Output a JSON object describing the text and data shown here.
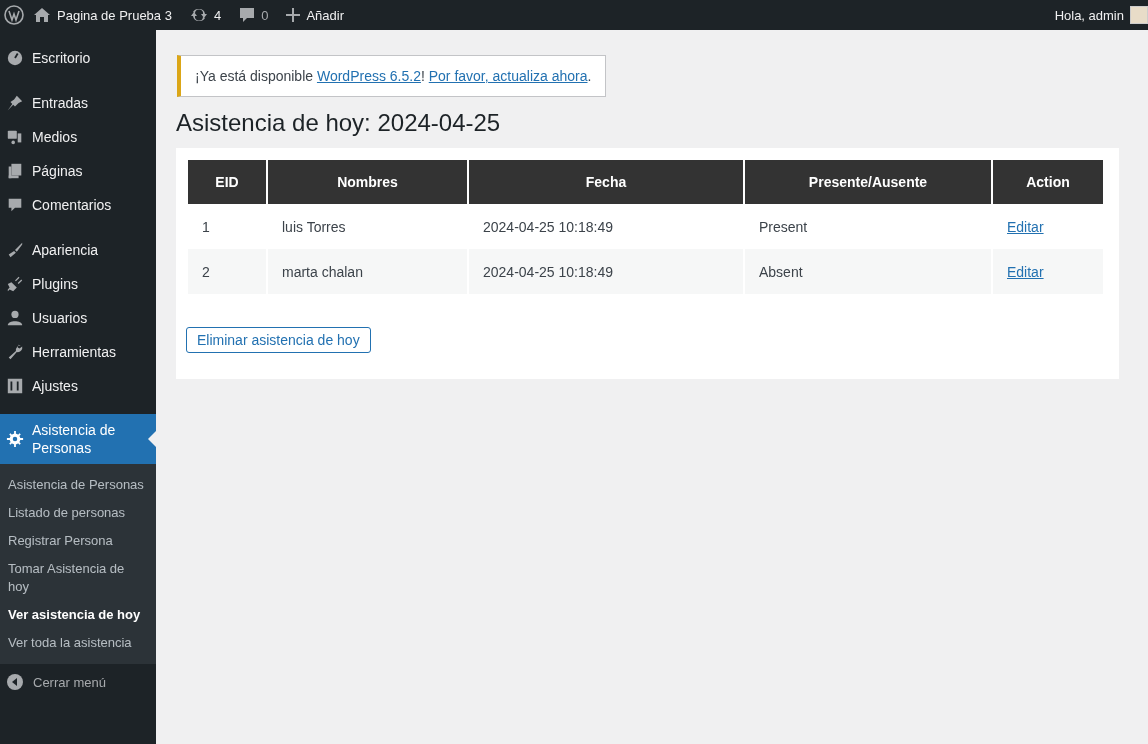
{
  "admin_bar": {
    "site_name": "Pagina de Prueba 3",
    "updates_count": "4",
    "comments_count": "0",
    "new_label": "Añadir",
    "greeting": "Hola, admin"
  },
  "sidebar": {
    "groups": [
      {
        "items": [
          {
            "label": "Escritorio",
            "kind": "dashboard",
            "selected": false
          }
        ]
      },
      {
        "items": [
          {
            "label": "Entradas",
            "kind": "pin",
            "selected": false
          },
          {
            "label": "Medios",
            "kind": "media",
            "selected": false
          },
          {
            "label": "Páginas",
            "kind": "pages",
            "selected": false
          },
          {
            "label": "Comentarios",
            "kind": "comment",
            "selected": false
          }
        ]
      },
      {
        "items": [
          {
            "label": "Apariencia",
            "kind": "brush",
            "selected": false
          },
          {
            "label": "Plugins",
            "kind": "plug",
            "selected": false
          },
          {
            "label": "Usuarios",
            "kind": "user",
            "selected": false
          },
          {
            "label": "Herramientas",
            "kind": "wrench",
            "selected": false
          },
          {
            "label": "Ajustes",
            "kind": "sliders",
            "selected": false
          }
        ]
      },
      {
        "items": [
          {
            "label": "Asistencia de Personas",
            "kind": "gear",
            "selected": true
          }
        ]
      }
    ],
    "submenu": [
      {
        "label": "Asistencia de Personas",
        "selected": false
      },
      {
        "label": "Listado de personas",
        "selected": false
      },
      {
        "label": "Registrar Persona",
        "selected": false
      },
      {
        "label": "Tomar Asistencia de hoy",
        "selected": false
      },
      {
        "label": "Ver asistencia de hoy",
        "selected": true
      },
      {
        "label": "Ver toda la asistencia",
        "selected": false
      }
    ],
    "collapse_label": "Cerrar menú"
  },
  "notice": {
    "parts": [
      {
        "kind": "text",
        "text": "¡Ya está disponible "
      },
      {
        "kind": "link",
        "text": "WordPress 6.5.2"
      },
      {
        "kind": "text",
        "text": "! "
      },
      {
        "kind": "link",
        "text": "Por favor, actualiza ahora"
      },
      {
        "kind": "text",
        "text": "."
      }
    ]
  },
  "heading": "Asistencia de hoy: 2024-04-25",
  "table": {
    "columns": [
      "EID",
      "Nombres",
      "Fecha",
      "Presente/Ausente",
      "Action"
    ],
    "rows": [
      {
        "eid": "1",
        "name": "luis Torres",
        "date": "2024-04-25 10:18:49",
        "status": "Present",
        "action": "Editar"
      },
      {
        "eid": "2",
        "name": "marta chalan",
        "date": "2024-04-25 10:18:49",
        "status": "Absent",
        "action": "Editar"
      }
    ]
  },
  "delete_button": "Eliminar asistencia de hoy"
}
